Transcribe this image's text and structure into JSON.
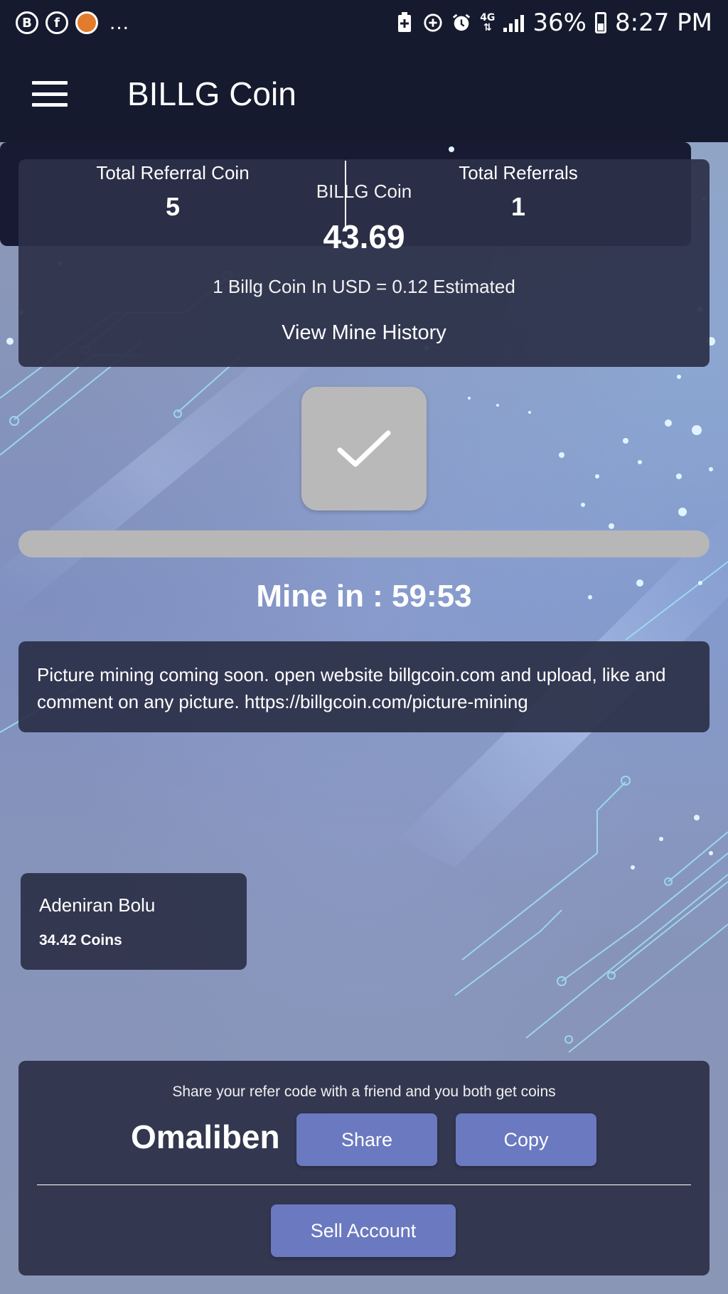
{
  "status_bar": {
    "left_icons": [
      "b-app-icon",
      "facebook-icon",
      "orange-app-icon"
    ],
    "left_icon_glyphs": [
      "B",
      "f",
      ""
    ],
    "overflow_dots": "...",
    "network_type": "4G",
    "battery_percent": "36%",
    "time": "8:27 PM"
  },
  "app_bar": {
    "title": "BILLG Coin"
  },
  "coin_card": {
    "label": "BILLG Coin",
    "amount": "43.69",
    "rate": "1 Billg Coin In USD = 0.12 Estimated",
    "history_link": "View Mine History"
  },
  "mining": {
    "timer_text": "Mine in : 59:53",
    "progress_fraction": 1.0
  },
  "notice": {
    "text": "Picture mining coming soon. open website billgcoin.com and upload, like and comment on any picture. https://billgcoin.com/picture-mining"
  },
  "referrals": {
    "coin_label": "Total Referral Coin",
    "coin_value": "5",
    "count_label": "Total Referrals",
    "count_value": "1"
  },
  "referral_users": [
    {
      "name": "Adeniran Bolu",
      "coins": "34.42 Coins"
    }
  ],
  "share": {
    "text": "Share your refer code with a friend and you both get coins",
    "code": "Omaliben",
    "share_label": "Share",
    "copy_label": "Copy",
    "sell_label": "Sell Account"
  },
  "colors": {
    "header_bg": "#161a2e",
    "card_bg": "#2c3048",
    "referral_bg": "#181a33",
    "button_bg": "#6a79c0",
    "mine_button_bg": "#b9b9b9"
  }
}
